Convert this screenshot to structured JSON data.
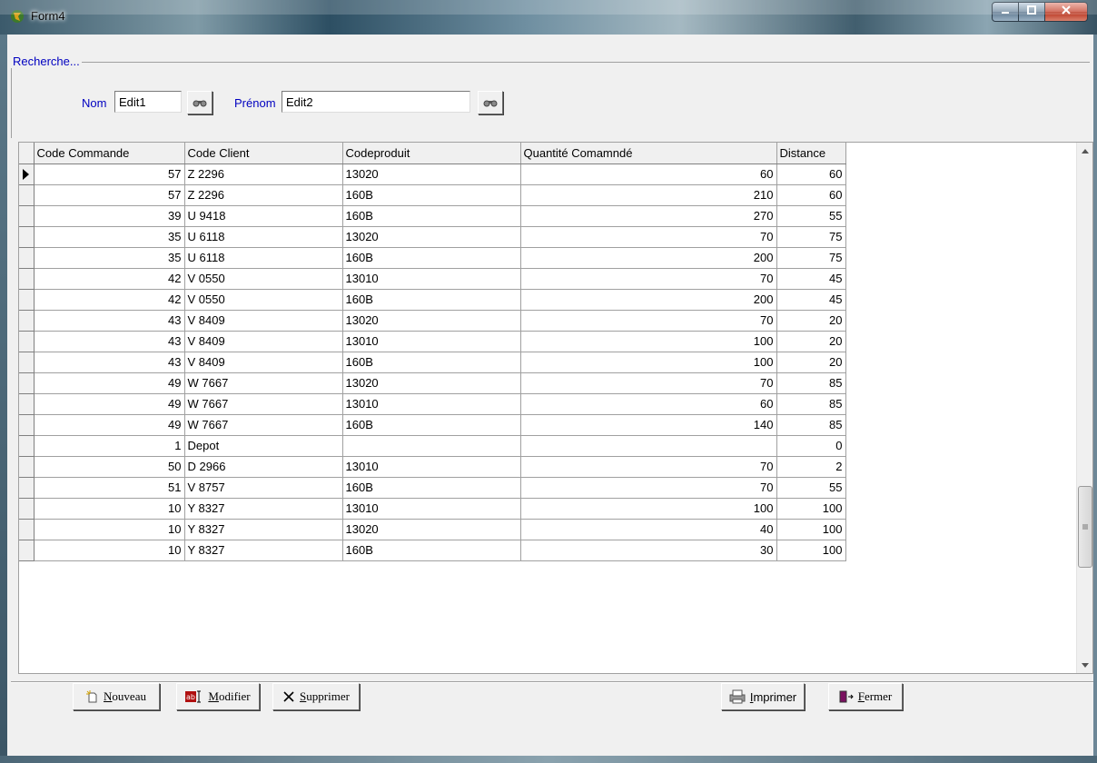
{
  "window": {
    "title": "Form4"
  },
  "search": {
    "group_label": "Recherche...",
    "nom_label": "Nom",
    "nom_value": "Edit1",
    "prenom_label": "Prénom",
    "prenom_value": "Edit2"
  },
  "grid": {
    "columns": [
      "Code Commande",
      "Code Client",
      "Codeproduit",
      "Quantité Comamndé",
      "Distance"
    ],
    "rows": [
      [
        "57",
        "Z 2296",
        "13020",
        "60",
        "60"
      ],
      [
        "57",
        "Z 2296",
        "160B",
        "210",
        "60"
      ],
      [
        "39",
        "U 9418",
        "160B",
        "270",
        "55"
      ],
      [
        "35",
        "U 6118",
        "13020",
        "70",
        "75"
      ],
      [
        "35",
        "U 6118",
        "160B",
        "200",
        "75"
      ],
      [
        "42",
        "V 0550",
        "13010",
        "70",
        "45"
      ],
      [
        "42",
        "V 0550",
        "160B",
        "200",
        "45"
      ],
      [
        "43",
        "V 8409",
        "13020",
        "70",
        "20"
      ],
      [
        "43",
        "V 8409",
        "13010",
        "100",
        "20"
      ],
      [
        "43",
        "V 8409",
        "160B",
        "100",
        "20"
      ],
      [
        "49",
        "W 7667",
        "13020",
        "70",
        "85"
      ],
      [
        "49",
        "W 7667",
        "13010",
        "60",
        "85"
      ],
      [
        "49",
        "W 7667",
        "160B",
        "140",
        "85"
      ],
      [
        "1",
        "Depot",
        "",
        "",
        "0"
      ],
      [
        "50",
        "D 2966",
        "13010",
        "70",
        "2"
      ],
      [
        "51",
        "V 8757",
        "160B",
        "70",
        "55"
      ],
      [
        "10",
        "Y 8327",
        "13010",
        "100",
        "100"
      ],
      [
        "10",
        "Y 8327",
        "13020",
        "40",
        "100"
      ],
      [
        "10",
        "Y 8327",
        "160B",
        "30",
        "100"
      ]
    ]
  },
  "buttons": {
    "nouveau": "Nouveau",
    "modifier": "Modifier",
    "supprimer": "Supprimer",
    "imprimer": "Imprimer",
    "fermer": "Fermer"
  },
  "colors": {
    "label_blue": "#0000c0",
    "face": "#f0f0f0"
  }
}
